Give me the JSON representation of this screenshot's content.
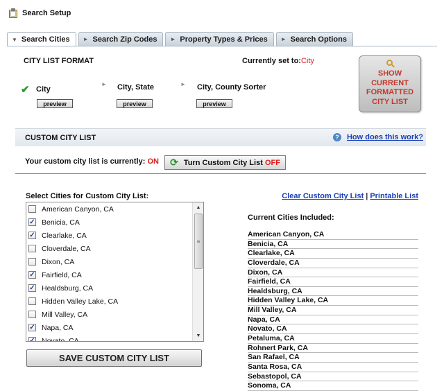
{
  "header": {
    "title": "Search Setup",
    "icon": "clipboard-icon"
  },
  "tabs": [
    {
      "label": "Search Cities",
      "arrow": "▼",
      "active": true
    },
    {
      "label": "Search Zip Codes",
      "arrow": "►"
    },
    {
      "label": "Property Types & Prices",
      "arrow": "►"
    },
    {
      "label": "Search Options",
      "arrow": "►"
    }
  ],
  "format": {
    "title": "CITY LIST FORMAT",
    "currently_label": "Currently set to:",
    "currently_value": "City",
    "options": [
      {
        "label": "City",
        "selected": true,
        "preview": "preview"
      },
      {
        "label": "City, State",
        "selected": false,
        "preview": "preview"
      },
      {
        "label": "City, County Sorter",
        "selected": false,
        "preview": "preview"
      }
    ],
    "show_button": [
      "SHOW",
      "CURRENT",
      "FORMATTED",
      "CITY LIST"
    ]
  },
  "custom": {
    "title": "CUSTOM CITY LIST",
    "help_link": "How does this work?",
    "status_label": "Your custom city list is currently:",
    "status_value": "ON",
    "toggle_label": "Turn Custom City List",
    "toggle_state": "OFF"
  },
  "select": {
    "label": "Select Cities for Custom City List:",
    "items": [
      {
        "name": "American Canyon, CA",
        "checked": false
      },
      {
        "name": "Benicia, CA",
        "checked": true
      },
      {
        "name": "Clearlake, CA",
        "checked": true
      },
      {
        "name": "Cloverdale, CA",
        "checked": false
      },
      {
        "name": "Dixon, CA",
        "checked": false
      },
      {
        "name": "Fairfield, CA",
        "checked": true
      },
      {
        "name": "Healdsburg, CA",
        "checked": true
      },
      {
        "name": "Hidden Valley Lake, CA",
        "checked": false
      },
      {
        "name": "Mill Valley, CA",
        "checked": false
      },
      {
        "name": "Napa, CA",
        "checked": true
      },
      {
        "name": "Novato, CA",
        "checked": true
      }
    ],
    "save_button": "SAVE CUSTOM CITY LIST"
  },
  "links": {
    "clear": "Clear Custom City List",
    "separator": "|",
    "print": "Printable List"
  },
  "current": {
    "label": "Current Cities Included:",
    "items": [
      "American Canyon, CA",
      "Benicia, CA",
      "Clearlake, CA",
      "Cloverdale, CA",
      "Dixon, CA",
      "Fairfield, CA",
      "Healdsburg, CA",
      "Hidden Valley Lake, CA",
      "Mill Valley, CA",
      "Napa, CA",
      "Novato, CA",
      "Petaluma, CA",
      "Rohnert Park, CA",
      "San Rafael, CA",
      "Santa Rosa, CA",
      "Sebastopol, CA",
      "Sonoma, CA"
    ]
  }
}
